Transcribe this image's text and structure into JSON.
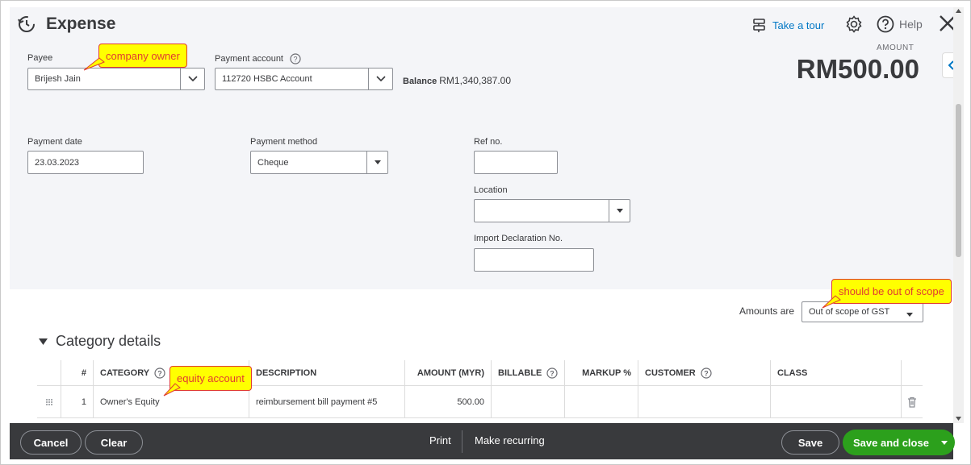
{
  "header": {
    "title": "Expense",
    "take_tour": "Take a tour",
    "help": "Help",
    "amount_label": "AMOUNT",
    "amount": "RM500.00"
  },
  "payee": {
    "label": "Payee",
    "value": "Brijesh Jain"
  },
  "payment_account": {
    "label": "Payment account",
    "value": "112720 HSBC Account",
    "balance_label": "Balance",
    "balance_value": "RM1,340,387.00"
  },
  "payment_date": {
    "label": "Payment date",
    "value": "23.03.2023"
  },
  "payment_method": {
    "label": "Payment method",
    "value": "Cheque"
  },
  "ref_no": {
    "label": "Ref no.",
    "value": ""
  },
  "location": {
    "label": "Location",
    "value": ""
  },
  "import_declaration": {
    "label": "Import Declaration No.",
    "value": ""
  },
  "amounts_are": {
    "label": "Amounts are",
    "value": "Out of scope of GST"
  },
  "category_details": {
    "title": "Category details",
    "columns": [
      "#",
      "CATEGORY",
      "DESCRIPTION",
      "AMOUNT (MYR)",
      "BILLABLE",
      "MARKUP %",
      "CUSTOMER",
      "CLASS"
    ],
    "rows": [
      {
        "num": "1",
        "category": "Owner's Equity",
        "description": "reimbursement bill payment #5",
        "amount": "500.00"
      }
    ]
  },
  "callouts": {
    "payee": "company owner",
    "scope": "should be out of scope",
    "category": "equity account"
  },
  "footer": {
    "cancel": "Cancel",
    "clear": "Clear",
    "print": "Print",
    "make_recurring": "Make recurring",
    "save": "Save",
    "save_and_close": "Save and close"
  },
  "colors": {
    "primary_green": "#2ca01c",
    "link_blue": "#0077c5",
    "footer_bg": "#393a3d",
    "callout_yellow": "#ffff00",
    "callout_red": "#e03c31"
  }
}
